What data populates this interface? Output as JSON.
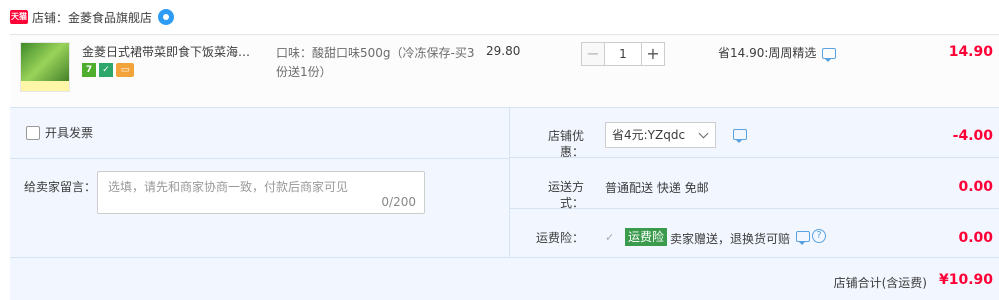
{
  "shop": {
    "badge": "天猫",
    "name": "店铺：金菱食品旗舰店"
  },
  "item": {
    "title": "金菱日式裙带菜即食下饭菜海带…",
    "spec": "口味：酸甜口味500g（冷冻保存-买3份送1份）",
    "price": "29.80",
    "quantity": "1",
    "minus_label": "−",
    "plus_label": "+",
    "promo": "省14.90:周周精选",
    "subtotal": "14.90",
    "service_icons": [
      "7",
      "shield-icon",
      "card-icon"
    ]
  },
  "invoice": {
    "label": "开具发票",
    "checked": false
  },
  "message": {
    "label": "给卖家留言：",
    "placeholder": "选填，请先和商家协商一致，付款后商家可见",
    "count": "0/200"
  },
  "options": {
    "coupon": {
      "label": "店铺优惠：",
      "selected": "省4元:YZqdc",
      "value": "-4.00"
    },
    "shipping": {
      "label": "运送方式：",
      "text": "普通配送 快递 免邮",
      "value": "0.00"
    },
    "insurance": {
      "label": "运费险：",
      "tag": "运费险",
      "text": "卖家赠送，退换货可赔",
      "value": "0.00",
      "checked": true
    }
  },
  "total": {
    "label": "店铺合计(含运费)",
    "value": "¥10.90"
  },
  "colors": {
    "accent_red": "#ff0036",
    "panel_blue": "#f2f7ff",
    "insurance_green": "#3a9b4c",
    "link_blue": "#5aa3e0"
  }
}
